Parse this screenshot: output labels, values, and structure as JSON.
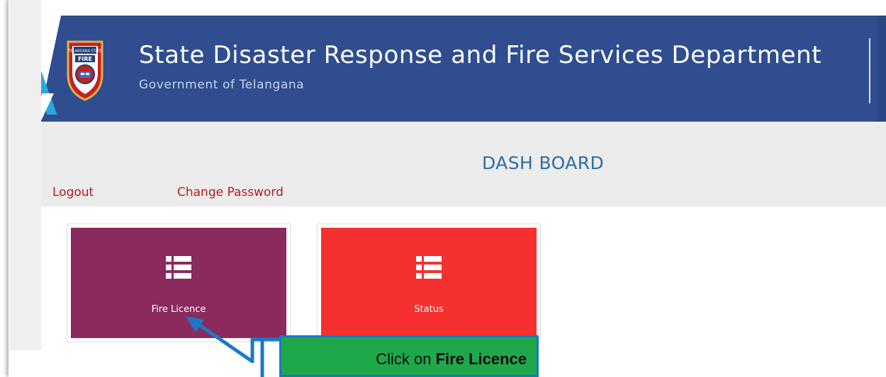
{
  "header": {
    "title": "State Disaster Response and Fire Services Department",
    "subtitle": "Government of Telangana",
    "logo": {
      "top_text": "TELANGANA STATE",
      "center_text": "FIRE"
    },
    "colors": {
      "background": "#2f4d8f",
      "accent": "#29a8e0"
    }
  },
  "dashboard": {
    "title": "DASH BOARD",
    "links": {
      "logout": "Logout",
      "change_password": "Change Password"
    },
    "tiles": [
      {
        "label": "Fire Licence",
        "icon": "list-icon",
        "color": "#8b2a5c"
      },
      {
        "label": "Status",
        "icon": "list-icon",
        "color": "#f53030"
      }
    ]
  },
  "callout": {
    "prefix": "Click on ",
    "emphasis": "Fire Licence",
    "background": "#1fa84a",
    "border": "#1b78c8"
  }
}
